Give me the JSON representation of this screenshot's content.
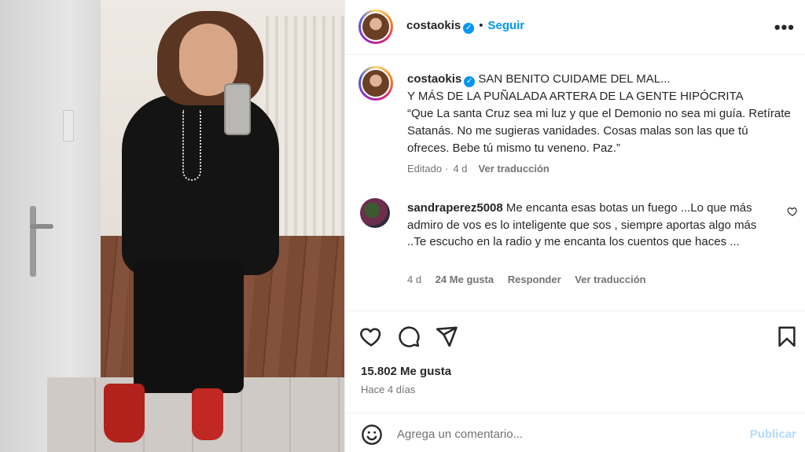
{
  "post": {
    "username": "costaokis",
    "follow_label": "Seguir",
    "dot": "•",
    "more_label": "•••",
    "caption_lines": [
      "SAN BENITO CUIDAME DEL MAL...",
      "Y MÁS DE LA PUÑALADA ARTERA DE LA GENTE HIPÓCRITA",
      "“Que La santa Cruz sea mi luz y que el Demonio no sea mi guía. Retírate Satanás. No me sugieras vanidades. Cosas malas son las que tú ofreces. Bebe tú mismo tu veneno. Paz.”"
    ],
    "caption_meta": {
      "edited": "Editado",
      "sep": "·",
      "age": "4 d",
      "translate": "Ver traducción"
    }
  },
  "comment": {
    "username": "sandraperez5008",
    "text": "Me encanta esas botas un fuego ...Lo que más admiro de vos es lo inteligente que sos , siempre aportas algo más ..Te escucho en la radio y me encanta los cuentos que haces ...",
    "age": "4 d",
    "likes": "24 Me gusta",
    "reply": "Responder",
    "translate": "Ver traducción"
  },
  "actions": {
    "likes": "15.802 Me gusta",
    "time": "Hace 4 días"
  },
  "composer": {
    "placeholder": "Agrega un comentario...",
    "post_label": "Publicar"
  },
  "colors": {
    "accent": "#0095f6",
    "muted": "#737373",
    "post_disabled": "#b3dbff"
  }
}
